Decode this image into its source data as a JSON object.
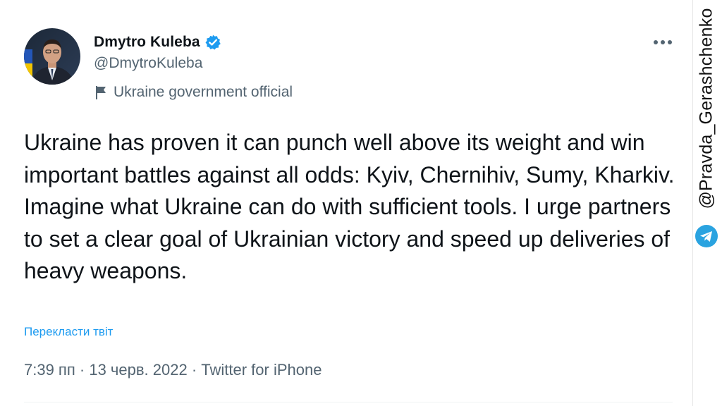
{
  "author": {
    "name": "Dmytro Kuleba",
    "handle": "@DmytroKuleba",
    "label": "Ukraine government official",
    "verified_icon": "verified-badge-icon",
    "label_icon": "flag-icon"
  },
  "tweet": {
    "text": "Ukraine has proven it can punch well above its weight and win important battles against all odds: Kyiv, Chernihiv, Sumy, Kharkiv. Imagine what Ukraine can do with sufficient tools. I urge partners to set a clear goal of Ukrainian victory and speed up deliveries of heavy weapons.",
    "translate_label": "Перекласти твіт",
    "time": "7:39 пп",
    "separator": " · ",
    "date": "13 черв. 2022",
    "source": "Twitter for iPhone"
  },
  "menu": {
    "icon": "more-options-icon"
  },
  "watermark": {
    "text": "@Pravda_Gerashchenko",
    "icon": "telegram-icon"
  },
  "colors": {
    "text_primary": "#0f1419",
    "text_secondary": "#536471",
    "accent": "#1d9bf0"
  }
}
